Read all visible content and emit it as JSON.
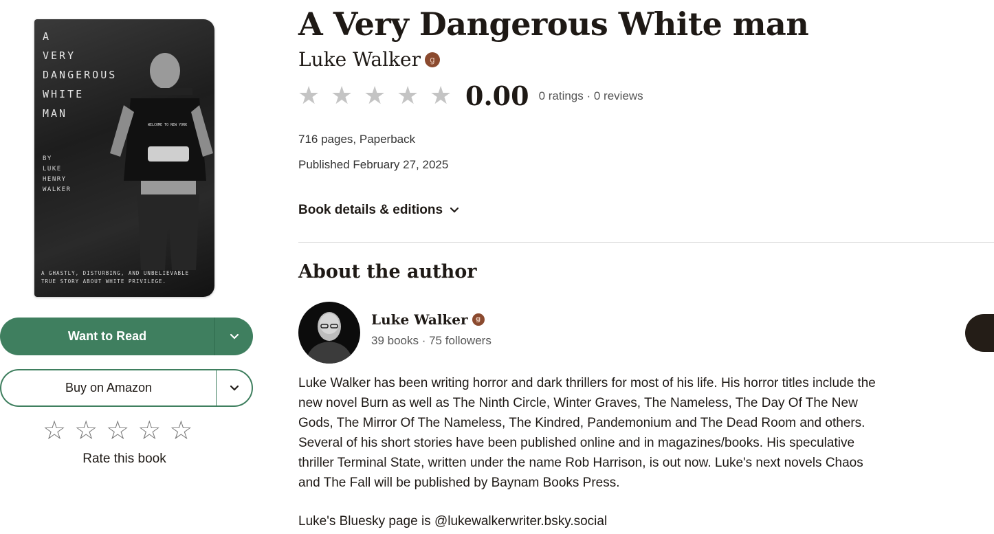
{
  "cover": {
    "title_lines": [
      "A",
      "VERY",
      "DANGEROUS",
      "WHITE",
      "MAN"
    ],
    "by_lines": [
      "BY",
      "LUKE",
      "HENRY",
      "WALKER"
    ],
    "tagline_lines": [
      "A GHASTLY, DISTURBING, AND UNBELIEVABLE",
      "TRUE STORY ABOUT WHITE PRIVILEGE."
    ],
    "shirt_text": "WELCOME TO NEW YORK"
  },
  "actions": {
    "want_to_read": "Want to Read",
    "buy": "Buy on Amazon",
    "rate_label": "Rate this book",
    "rate_stars": [
      "☆",
      "☆",
      "☆",
      "☆",
      "☆"
    ]
  },
  "book": {
    "title": "A Very Dangerous White man",
    "author": "Luke Walker",
    "author_badge": "g",
    "rating_stars": [
      "★",
      "★",
      "★",
      "★",
      "★"
    ],
    "average_rating": "0.00",
    "rating_meta": "0 ratings · 0 reviews",
    "pages_format": "716 pages, Paperback",
    "published": "Published February 27, 2025",
    "details_link": "Book details & editions"
  },
  "about": {
    "heading": "About the author",
    "name": "Luke Walker",
    "badge": "g",
    "stats": "39 books · 75 followers",
    "bio_lines": [
      "Luke Walker has been writing horror and dark thrillers for most of his life. His horror titles include the",
      "new novel Burn as well as The Ninth Circle, Winter Graves, The Nameless, The Day Of The New",
      "Gods, The Mirror Of The Nameless, The Kindred, Pandemonium and The Dead Room and others.",
      "Several of his short stories have been published online and in magazines/books. His speculative",
      "thriller Terminal State, written under the name Rob Harrison, is out now. Luke's next novels Chaos",
      "and The Fall will be published by Baynam Books Press."
    ],
    "bluesky": "Luke's Bluesky page is @lukewalkerwriter.bsky.social"
  },
  "colors": {
    "primary": "#3f7f5f",
    "text": "#1e1915",
    "badge": "#8b4a2f",
    "star_empty": "#c4c4c4"
  }
}
